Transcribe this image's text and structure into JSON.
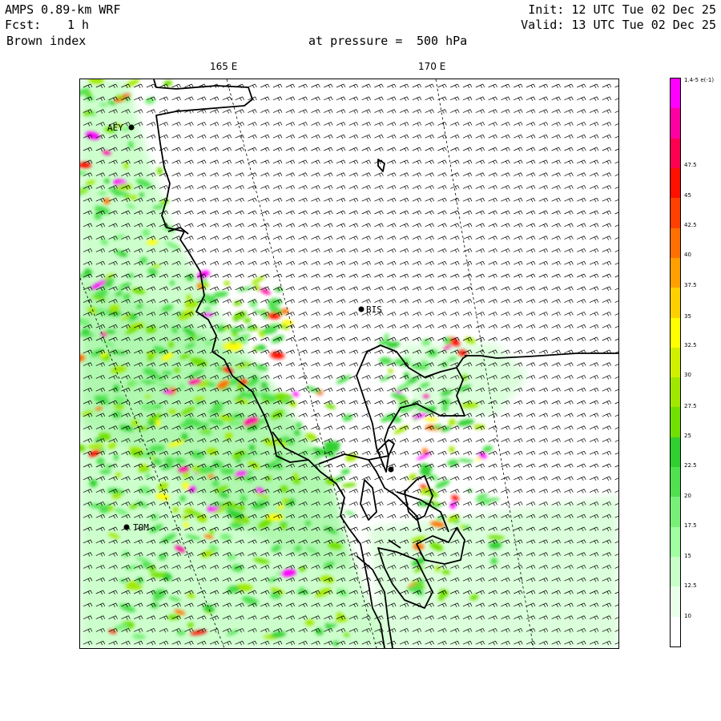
{
  "header": {
    "model": "AMPS 0.89-km WRF",
    "fcst_label": "Fcst:",
    "fcst_value": "1 h",
    "field": "Brown index",
    "pressure_label": "at pressure =",
    "pressure_value": "500 hPa",
    "init": "Init: 12 UTC Tue 02 Dec 25",
    "valid": "Valid: 13 UTC Tue 02 Dec 25"
  },
  "map": {
    "longitude_labels": [
      "165 E",
      "170 E"
    ],
    "stations": [
      {
        "code": "AEY",
        "label": "AEY"
      },
      {
        "code": "BIS",
        "label": "BIS"
      },
      {
        "code": "TOM",
        "label": "TOM"
      },
      {
        "code": "unlabeled",
        "label": ""
      }
    ]
  },
  "colorbar": {
    "top_label": "1.4-5 e(-1)",
    "levels": [
      "47.5",
      "45",
      "42.5",
      "40",
      "37.5",
      "35",
      "32.5",
      "30",
      "27.5",
      "25",
      "22.5",
      "20",
      "17.5",
      "15",
      "12.5",
      "10"
    ],
    "colors": [
      "#ffffff",
      "#eaffea",
      "#c8ffc8",
      "#a0ffa0",
      "#78f078",
      "#50e050",
      "#30d030",
      "#70e000",
      "#a0e800",
      "#d0f000",
      "#ffff00",
      "#ffd000",
      "#ffa000",
      "#ff7000",
      "#ff4000",
      "#ff1000",
      "#ff0050",
      "#ff00a0",
      "#ff00ff"
    ],
    "level_positions": [
      0.17,
      0.23,
      0.287,
      0.345,
      0.404,
      0.465,
      0.522,
      0.58,
      0.64,
      0.698,
      0.757,
      0.816,
      0.874,
      0.933,
      0.99,
      1.05
    ]
  }
}
